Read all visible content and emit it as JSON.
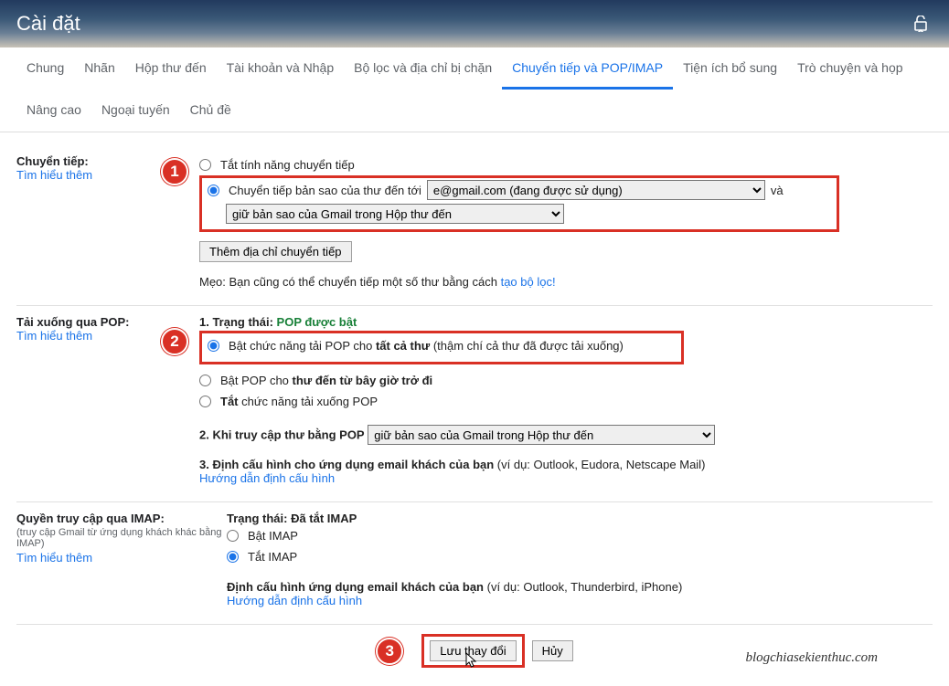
{
  "header": {
    "title": "Cài đặt"
  },
  "tabs": {
    "row1": [
      "Chung",
      "Nhãn",
      "Hộp thư đến",
      "Tài khoản và Nhập",
      "Bộ lọc và địa chỉ bị chặn",
      "Chuyển tiếp và POP/IMAP",
      "Tiện ích bổ sung",
      "Trò chuyện và họp"
    ],
    "row2": [
      "Nâng cao",
      "Ngoại tuyến",
      "Chủ đề"
    ],
    "activeIndex": 5
  },
  "forwarding": {
    "label": "Chuyển tiếp:",
    "learn": "Tìm hiểu thêm",
    "disable": "Tắt tính năng chuyển tiếp",
    "enablePrefix": "Chuyển tiếp bản sao của thư đến tới",
    "emailSelect": "e@gmail.com (đang được sử dụng)",
    "and": "và",
    "keepCopy": "giữ bản sao của Gmail trong Hộp thư đến",
    "addBtn": "Thêm địa chỉ chuyển tiếp",
    "tipPrefix": "Mẹo: Bạn cũng có thể chuyển tiếp một số thư bằng cách ",
    "tipLink": "tạo bộ lọc!"
  },
  "pop": {
    "label": "Tải xuống qua POP:",
    "learn": "Tìm hiểu thêm",
    "statusLabel": "1. Trạng thái:",
    "statusValue": "POP được bật",
    "enableAllPrefix": "Bật chức năng tải POP cho ",
    "enableAllBold": "tất cả thư",
    "enableAllSuffix": " (thậm chí cả thư đã được tải xuống)",
    "enableNewPrefix": "Bật POP cho ",
    "enableNewBold": "thư đến từ bây giờ trở đi",
    "disablePrefix": "Tắt",
    "disableSuffix": " chức năng tải xuống POP",
    "step2Label": "2. Khi truy cập thư bằng POP",
    "step2Select": "giữ bản sao của Gmail trong Hộp thư đến",
    "step3Label": "3. Định cấu hình cho ứng dụng email khách của bạn",
    "step3Examples": " (ví dụ: Outlook, Eudora, Netscape Mail)",
    "guideLink": "Hướng dẫn định cấu hình"
  },
  "imap": {
    "label": "Quyền truy cập qua IMAP:",
    "sub": "(truy cập Gmail từ ứng dụng khách khác bằng IMAP)",
    "learn": "Tìm hiểu thêm",
    "statusLabel": "Trạng thái:",
    "statusValue": "Đã tắt IMAP",
    "enable": "Bật IMAP",
    "disable": "Tắt IMAP",
    "configLabel": "Định cấu hình ứng dụng email khách của bạn",
    "configExamples": " (ví dụ: Outlook, Thunderbird, iPhone)",
    "guideLink": "Hướng dẫn định cấu hình"
  },
  "footer": {
    "save": "Lưu thay đổi",
    "cancel": "Hủy",
    "credit": "blogchiasekienthuc.com"
  },
  "badges": {
    "b1": "1",
    "b2": "2",
    "b3": "3"
  }
}
